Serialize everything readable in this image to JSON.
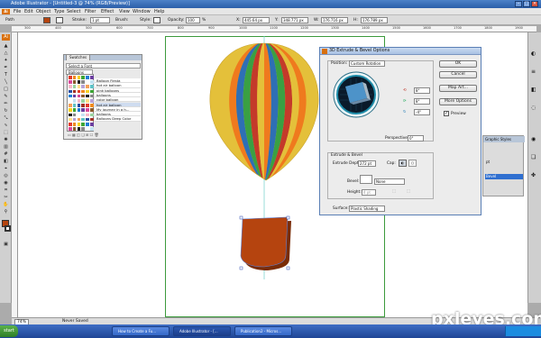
{
  "window": {
    "title": "Adobe Illustrator - [Untitled-3 @ 74% (RGB/Preview)]"
  },
  "menu": {
    "logo": "Ai",
    "items": [
      "File",
      "Edit",
      "Object",
      "Type",
      "Select",
      "Filter",
      "Effect",
      "View",
      "Window",
      "Help"
    ]
  },
  "control": {
    "path_label": "Path",
    "stroke_label": "Stroke:",
    "stroke_value": "1 pt",
    "brush_label": "Brush:",
    "style_label": "Style:",
    "opacity_label": "Opacity:",
    "opacity_value": "100",
    "opacity_unit": "%",
    "x_label": "X:",
    "x_value": "445.64 px",
    "y_label": "Y:",
    "y_value": "348.771 px",
    "w_label": "W:",
    "w_value": "176.716 px",
    "h_label": "H:",
    "h_value": "176.789 px",
    "fill_color": "#b5440f"
  },
  "ruler_ticks": [
    "300",
    "400",
    "500",
    "600",
    "700",
    "800",
    "900",
    "1000",
    "1100",
    "1200",
    "1300",
    "1400",
    "1500",
    "1600",
    "1700",
    "1800",
    "1900"
  ],
  "swatches": {
    "tab": "Swatches",
    "select_label": "Select a Font",
    "search_value": "Balloons",
    "list": [
      "Balloon Fiesta",
      "hot air balloon",
      "pink balloons",
      "balloons",
      "color balloon",
      "hot air balloon",
      "My journey in a h...",
      "balloons",
      "Balloons Deep Color"
    ],
    "grid_colors": [
      "#e23b2a",
      "#f08b1f",
      "#f7d21f",
      "#3fa535",
      "#1f7fd6",
      "#6b3fa0",
      "#d84a9a",
      "#8b5a2b",
      "#222222",
      "#888888",
      "#ffffff",
      "#c4e3f3",
      "#f7b9c9",
      "#9bd3a0",
      "#ffe08a",
      "#b7a2d6",
      "#f5a05a",
      "#5fc2c6",
      "#2b4fa3",
      "#a33226"
    ]
  },
  "dialog": {
    "title": "3D Extrude & Bevel Options",
    "buttons": {
      "ok": "OK",
      "cancel": "Cancel",
      "map_art": "Map Art...",
      "more_options": "More Options"
    },
    "preview_label": "Preview",
    "position_label": "Position:",
    "position_value": "Custom Rotation",
    "angles": [
      "8°",
      "8°",
      "-4°"
    ],
    "perspective_label": "Perspective:",
    "perspective_value": "0°",
    "extrude_group_label": "Extrude & Bevel",
    "extrude_depth_label": "Extrude Depth:",
    "extrude_depth_value": "272 pt",
    "cap_label": "Cap:",
    "bevel_label": "Bevel:",
    "bevel_value": "None",
    "height_label": "Height:",
    "height_value": "4 pt",
    "surface_label": "Surface:",
    "surface_value": "Plastic Shading"
  },
  "right_panel": {
    "tab": "Graphic Styles",
    "items": [
      "pt",
      "Bevel"
    ]
  },
  "statusbar": {
    "zoom": "74%",
    "status": "Never Saved"
  },
  "taskbar": {
    "start": "start",
    "tasks": [
      "How to Create a Fu...",
      "Adobe Illustrator - [...",
      "Publication2 - Micros..."
    ]
  },
  "watermark": "pxleyes.com",
  "balloon": {
    "stripe_colors": [
      "#e4c03a",
      "#ef7a1e",
      "#2e6fb5",
      "#3aa043",
      "#c43a2a"
    ],
    "basket_color": "#b5440f",
    "basket_shade": "#7a2c07"
  }
}
